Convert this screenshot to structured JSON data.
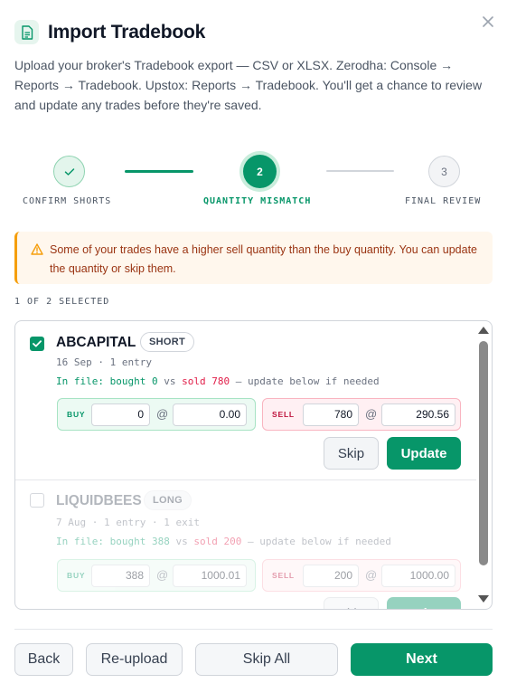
{
  "header": {
    "title": "Import Tradebook",
    "description": "Upload your broker's Tradebook export — CSV or XLSX. Zerodha: Console → Reports → Tradebook. Upstox: Reports → Tradebook. You'll get a chance to review and update any trades before they're saved."
  },
  "stepper": {
    "steps": [
      {
        "label": "CONFIRM SHORTS",
        "state": "done"
      },
      {
        "label": "QUANTITY MISMATCH",
        "number": "2",
        "state": "active"
      },
      {
        "label": "FINAL REVIEW",
        "number": "3",
        "state": "pending"
      }
    ]
  },
  "warning": {
    "text": "Some of your trades have a higher sell quantity than the buy quantity. You can update the quantity or skip them."
  },
  "selection": {
    "count_label": "1 OF 2 SELECTED"
  },
  "trades": [
    {
      "symbol": "ABCAPITAL",
      "badge": "SHORT",
      "selected": true,
      "meta": "16 Sep · 1 entry",
      "infile_prefix": "In file: ",
      "bought": "bought 0",
      "vs": " vs ",
      "sold": "sold 780",
      "infile_suffix": " — update below if needed",
      "buy_label": "BUY",
      "buy_qty": "0",
      "buy_price": "0.00",
      "sell_label": "SELL",
      "sell_qty": "780",
      "sell_price": "290.56",
      "at": "@",
      "skip_label": "Skip",
      "update_label": "Update"
    },
    {
      "symbol": "LIQUIDBEES",
      "badge": "LONG",
      "selected": false,
      "meta": "7 Aug · 1 entry · 1 exit",
      "infile_prefix": "In file: ",
      "bought": "bought 388",
      "vs": " vs ",
      "sold": "sold 200",
      "infile_suffix": " — update below if needed",
      "buy_label": "BUY",
      "buy_qty": "388",
      "buy_price": "1000.01",
      "sell_label": "SELL",
      "sell_qty": "200",
      "sell_price": "1000.00",
      "at": "@",
      "skip_label": "Skip",
      "update_label": "Update"
    }
  ],
  "footer": {
    "back_label": "Back",
    "reupload_label": "Re-upload",
    "skip_all_label": "Skip All",
    "next_label": "Next"
  },
  "colors": {
    "accent": "#079669",
    "warning": "#f59e0b",
    "sell": "#e11d48"
  }
}
